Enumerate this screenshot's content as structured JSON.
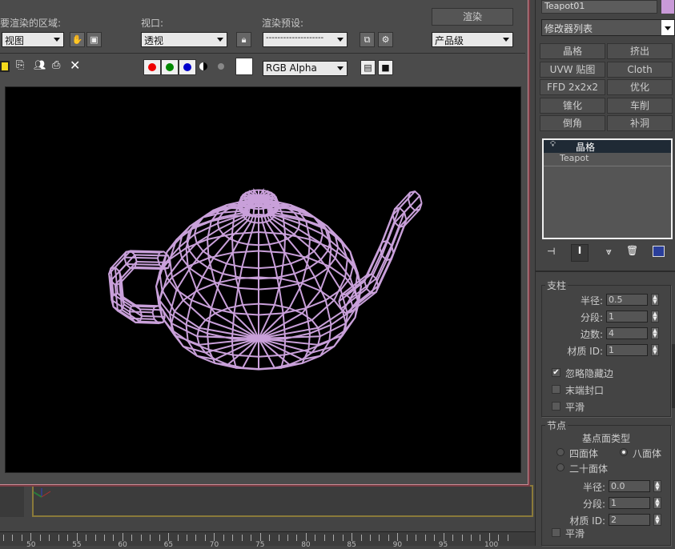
{
  "render": {
    "area_label": "要渲染的区域:",
    "area_value": "视图",
    "viewport_label": "视口:",
    "viewport_value": "透视",
    "preset_label": "渲染预设:",
    "preset_value": "--------------------",
    "render_button": "渲染",
    "quality_value": "产品级",
    "channel_value": "RGB Alpha",
    "wire_color": "#c9a0da"
  },
  "panel": {
    "object_name": "Teapot01",
    "object_color": "#c99ad8",
    "modifier_list": "修改器列表",
    "modifier_buttons": [
      "晶格",
      "挤出",
      "UVW 贴图",
      "Cloth",
      "FFD 2x2x2",
      "优化",
      "锥化",
      "车削",
      "倒角",
      "补洞"
    ],
    "stack": [
      "晶格",
      "Teapot"
    ],
    "struts": {
      "title": "支柱",
      "fields": [
        {
          "label": "半径:",
          "value": "0.5"
        },
        {
          "label": "分段:",
          "value": "1"
        },
        {
          "label": "边数:",
          "value": "4"
        },
        {
          "label": "材质 ID:",
          "value": "1"
        }
      ],
      "checks": [
        {
          "label": "忽略隐藏边",
          "checked": true
        },
        {
          "label": "末端封口",
          "checked": false
        },
        {
          "label": "平滑",
          "checked": false
        }
      ]
    },
    "joints": {
      "title": "节点",
      "type_label": "基点面类型",
      "radios": [
        {
          "label": "四面体",
          "on": false
        },
        {
          "label": "八面体",
          "on": true
        },
        {
          "label": "二十面体",
          "on": false
        }
      ],
      "fields": [
        {
          "label": "半径:",
          "value": "0.0"
        },
        {
          "label": "分段:",
          "value": "1"
        },
        {
          "label": "材质 ID:",
          "value": "2"
        }
      ],
      "smooth": {
        "label": "平滑",
        "checked": false
      }
    }
  },
  "timeline": {
    "labels": [
      "50",
      "55",
      "60",
      "65",
      "70",
      "75",
      "80",
      "85",
      "90",
      "95",
      "100"
    ]
  }
}
